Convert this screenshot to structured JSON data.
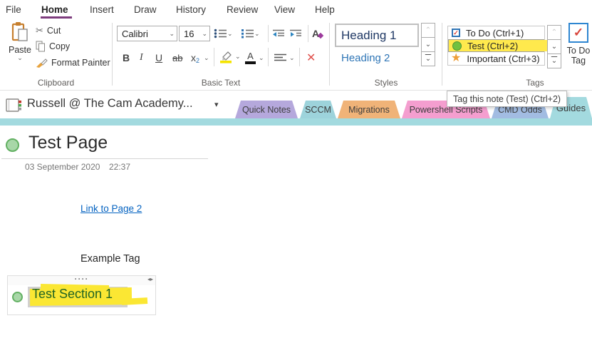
{
  "menu": {
    "items": [
      "File",
      "Home",
      "Insert",
      "Draw",
      "History",
      "Review",
      "View",
      "Help"
    ],
    "active": "Home"
  },
  "ribbon": {
    "clipboard": {
      "group_label": "Clipboard",
      "paste_label": "Paste",
      "cut_label": "Cut",
      "copy_label": "Copy",
      "format_painter_label": "Format Painter"
    },
    "basic_text": {
      "group_label": "Basic Text",
      "font_name": "Calibri",
      "font_size": "16",
      "bold_glyph": "B",
      "italic_glyph": "I",
      "underline_glyph": "U",
      "strike_glyph": "ab",
      "sub_base": "x",
      "sub_digit": "2",
      "fontcolor_glyph": "A",
      "clearformat_glyph": "A"
    },
    "styles": {
      "group_label": "Styles",
      "heading1": "Heading 1",
      "heading2": "Heading 2"
    },
    "tags": {
      "group_label": "Tags",
      "todo": "To Do (Ctrl+1)",
      "test": "Test (Ctrl+2)",
      "important": "Important (Ctrl+3)",
      "todo_tag_line1": "To Do",
      "todo_tag_line2": "Tag"
    }
  },
  "tooltip": {
    "text": "Tag this note (Test) (Ctrl+2)"
  },
  "navbar": {
    "notebook_title": "Russell @ The Cam Academy...",
    "tabs": [
      {
        "label": "Quick Notes",
        "color": "#b5a8dc"
      },
      {
        "label": "SCCM",
        "color": "#9dd3db"
      },
      {
        "label": "Migrations",
        "color": "#f0b378"
      },
      {
        "label": "Powershell Scripts",
        "color": "#f49ecf"
      },
      {
        "label": "CMD Odds",
        "color": "#a2bce2"
      },
      {
        "label": "Guides",
        "color": "#a3dadf"
      }
    ]
  },
  "page": {
    "title": "Test Page",
    "date": "03 September 2020",
    "time": "22:37",
    "link_text": "Link to Page 2",
    "example_tag": "Example Tag",
    "container_text": "Test Section 1"
  },
  "icons": {
    "dropdown": "⌄",
    "caret": "▾",
    "scissors": "✂",
    "check": "✓",
    "star": "★",
    "close": "✕",
    "up": "⌃",
    "down": "⌄",
    "more": "⌄",
    "left_small": "◂",
    "right_small": "▸",
    "dots": "····"
  },
  "colors": {
    "accent_purple": "#7d3c7d",
    "strip_teal": "#a3dadf",
    "highlight_yellow": "#ffe94d",
    "tag_green": "#71c13f",
    "page_tag_green_fill": "#a8d7a8",
    "page_tag_green_border": "#62b062",
    "important_orange": "#ee9e38",
    "todo_check_red": "#d8453c",
    "todo_border_blue": "#2e86d1",
    "heading1_text": "#1f3864",
    "heading2_text": "#2e75b6",
    "link_blue": "#0563c1"
  }
}
